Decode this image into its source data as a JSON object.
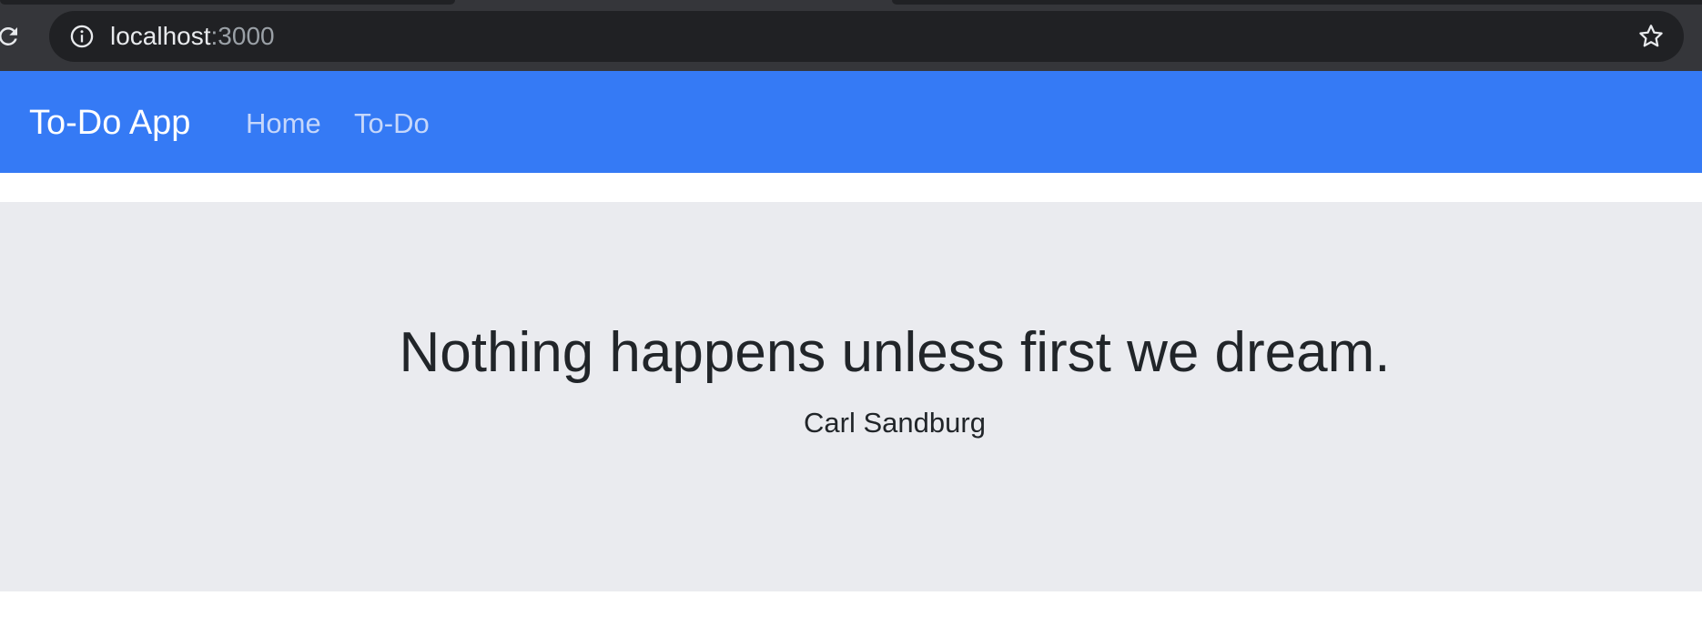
{
  "browser": {
    "url_host": "localhost",
    "url_port": ":3000"
  },
  "navbar": {
    "brand": "To-Do App",
    "links": [
      "Home",
      "To-Do"
    ]
  },
  "jumbotron": {
    "quote": "Nothing happens unless first we dream.",
    "author": "Carl Sandburg"
  },
  "colors": {
    "navbar_bg": "#357af5",
    "jumbotron_bg": "#eaebef",
    "browser_chrome": "#35363a"
  }
}
